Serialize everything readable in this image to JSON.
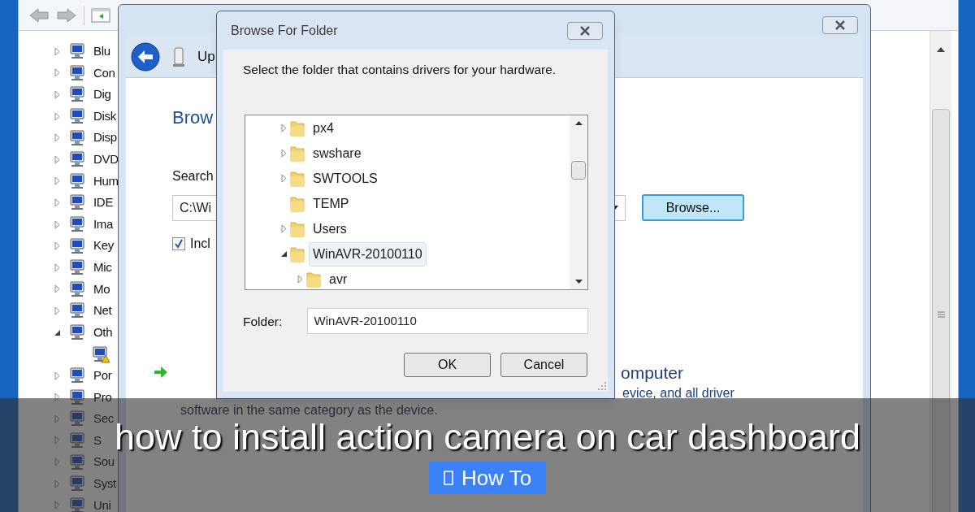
{
  "device_manager": {
    "tree": [
      {
        "label": "Blu",
        "expanded": false
      },
      {
        "label": "Con",
        "expanded": false
      },
      {
        "label": "Dig",
        "expanded": false
      },
      {
        "label": "Disk",
        "expanded": false
      },
      {
        "label": "Disp",
        "expanded": false
      },
      {
        "label": "DVD",
        "expanded": false
      },
      {
        "label": "Hum",
        "expanded": false
      },
      {
        "label": "IDE",
        "expanded": false
      },
      {
        "label": "Ima",
        "expanded": false
      },
      {
        "label": "Key",
        "expanded": false
      },
      {
        "label": "Mic",
        "expanded": false
      },
      {
        "label": "Mo",
        "expanded": false
      },
      {
        "label": "Net",
        "expanded": false
      },
      {
        "label": "Oth",
        "expanded": true,
        "children": [
          {
            "warning": true
          }
        ]
      },
      {
        "label": "Por",
        "expanded": false
      },
      {
        "label": "Pro",
        "expanded": false
      },
      {
        "label": "Sec",
        "expanded": false
      },
      {
        "label": "S",
        "expanded": false
      },
      {
        "label": "Sou",
        "expanded": false
      },
      {
        "label": "Syst",
        "expanded": false
      },
      {
        "label": "Uni",
        "expanded": false
      }
    ]
  },
  "wizard": {
    "header_title": "Up",
    "heading": "Brow",
    "search_label": "Search",
    "path_value": "C:\\Wi",
    "browse_button": "Browse...",
    "include_checkbox": {
      "label": "Incl",
      "checked": true
    },
    "option_lines": [
      "omputer",
      "evice, and all driver",
      "software in the same category as the device."
    ]
  },
  "dialog": {
    "title": "Browse For Folder",
    "instruction": "Select the folder that contains drivers for your hardware.",
    "folders": [
      {
        "label": "px4",
        "expandable": true,
        "expanded": false,
        "selected": false
      },
      {
        "label": "swshare",
        "expandable": true,
        "expanded": false,
        "selected": false
      },
      {
        "label": "SWTOOLS",
        "expandable": true,
        "expanded": false,
        "selected": false
      },
      {
        "label": "TEMP",
        "expandable": false,
        "selected": false
      },
      {
        "label": "Users",
        "expandable": true,
        "expanded": false,
        "selected": false
      },
      {
        "label": "WinAVR-20100110",
        "expandable": true,
        "expanded": true,
        "selected": true,
        "children": [
          {
            "label": "avr",
            "expandable": true,
            "expanded": false,
            "selected": false
          }
        ]
      }
    ],
    "folder_label": "Folder:",
    "folder_value": "WinAVR-20100110",
    "buttons": [
      "OK",
      "Cancel"
    ]
  },
  "overlay": {
    "title": "how to install action camera on car dashboard",
    "button": "How To"
  }
}
